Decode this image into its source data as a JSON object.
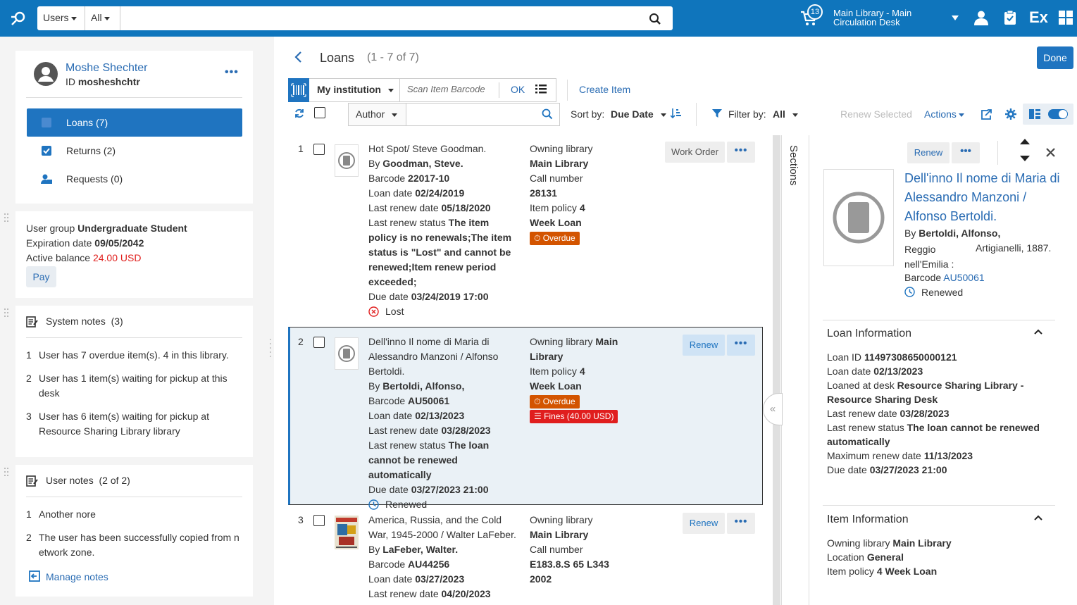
{
  "header": {
    "search_scope": "Users",
    "search_filter": "All",
    "cart_count": "13",
    "library_line1": "Main Library - Main",
    "library_line2": "Circulation Desk",
    "ex_label": "Ex"
  },
  "user": {
    "name": "Moshe Shechter",
    "id_label": "ID",
    "id_value": "mosheshchtr",
    "nav": [
      {
        "label": "Loans (7)"
      },
      {
        "label": "Returns  (2)"
      },
      {
        "label": "Requests  (0)"
      }
    ],
    "group_label": "User group",
    "group_value": "Undergraduate Student",
    "expiration_label": "Expiration date",
    "expiration_value": "09/05/2042",
    "balance_label": "Active balance",
    "balance_value": "24.00 USD",
    "pay_label": "Pay"
  },
  "system_notes": {
    "title": "System notes",
    "count": "(3)",
    "items": [
      {
        "n": "1",
        "text": "User has 7 overdue item(s). 4 in this library."
      },
      {
        "n": "2",
        "text": "User has 1 item(s) waiting for pickup at this desk"
      },
      {
        "n": "3",
        "text": "User has 6 item(s) waiting for pickup at Resource Sharing Library library"
      }
    ]
  },
  "user_notes": {
    "title": "User notes",
    "count": "(2 of 2)",
    "items": [
      {
        "n": "1",
        "text": "Another nore"
      },
      {
        "n": "2",
        "text": "The user has been successfully copied from n etwork zone."
      }
    ],
    "manage_label": "Manage notes"
  },
  "loans": {
    "title": "Loans",
    "count": "(1 - 7 of 7)",
    "done_label": "Done",
    "institution": "My institution",
    "scan_placeholder": "Scan Item Barcode",
    "ok_label": "OK",
    "create_item": "Create Item",
    "author_label": "Author",
    "sort_label": "Sort by:",
    "sort_value": "Due Date",
    "filter_label": "Filter by:",
    "filter_value": "All",
    "renew_selected": "Renew Selected",
    "actions_label": "Actions",
    "rows": [
      {
        "num": "1",
        "title": "Hot Spot/ Steve Goodman.",
        "by_label": "By",
        "by": "Goodman, Steve.",
        "barcode_label": "Barcode",
        "barcode": "22017-10",
        "loan_date_label": "Loan date",
        "loan_date": "02/24/2019",
        "last_renew_label": "Last renew date",
        "last_renew": "05/18/2020",
        "status_label": "Last renew status",
        "status": "The item policy is no renewals;The item status is \"Lost\" and cannot be renewed;Item renew period exceeded;",
        "due_label": "Due date",
        "due": "03/24/2019 17:00",
        "state": "Lost",
        "owning_label": "Owning library",
        "owning": "Main Library",
        "call_label": "Call number",
        "call": "28131",
        "policy_label": "Item policy",
        "policy": "4 Week Loan",
        "badge1": "Overdue",
        "action": "Work Order"
      },
      {
        "num": "2",
        "title": "Dell'inno Il nome di Maria di Alessandro Manzoni / Alfonso Bertoldi.",
        "by_label": "By",
        "by": "Bertoldi, Alfonso,",
        "barcode_label": "Barcode",
        "barcode": "AU50061",
        "loan_date_label": "Loan date",
        "loan_date": "02/13/2023",
        "last_renew_label": "Last renew date",
        "last_renew": "03/28/2023",
        "status_label": "Last renew status",
        "status": "The loan cannot be renewed automatically",
        "due_label": "Due date",
        "due": "03/27/2023 21:00",
        "state": "Renewed",
        "owning_label": "Owning library",
        "owning": "Main Library",
        "policy_label": "Item policy",
        "policy": "4 Week Loan",
        "badge1": "Overdue",
        "badge2": "Fines (40.00 USD)",
        "action": "Renew"
      },
      {
        "num": "3",
        "title": "America, Russia, and the Cold War, 1945-2000 / Walter LaFeber.",
        "by_label": "By",
        "by": "LaFeber, Walter.",
        "barcode_label": "Barcode",
        "barcode": "AU44256",
        "loan_date_label": "Loan date",
        "loan_date": "03/27/2023",
        "last_renew_label": "Last renew date",
        "last_renew": "04/20/2023",
        "owning_label": "Owning library",
        "owning": "Main Library",
        "call_label": "Call number",
        "call": "E183.8.S 65 L343 2002",
        "action": "Renew"
      }
    ]
  },
  "sections_label": "Sections",
  "detail": {
    "renew_label": "Renew",
    "title": "Dell'inno Il nome di Maria di Alessandro Manzoni / Alfonso Bertoldi.",
    "by_label": "By",
    "by": "Bertoldi, Alfonso,",
    "place": "Reggio nell'Emilia :",
    "publisher": "Artigianelli, 1887.",
    "barcode_label": "Barcode",
    "barcode": "AU50061",
    "state": "Renewed",
    "loan_info": {
      "title": "Loan Information",
      "loan_id_label": "Loan ID",
      "loan_id": "11497308650000121",
      "loan_date_label": "Loan date",
      "loan_date": "02/13/2023",
      "desk_label": "Loaned at desk",
      "desk": "Resource Sharing Library - Resource Sharing Desk",
      "last_renew_label": "Last renew date",
      "last_renew": "03/28/2023",
      "status_label": "Last renew status",
      "status": "The loan cannot be renewed automatically",
      "max_label": "Maximum renew date",
      "max": "11/13/2023",
      "due_label": "Due date",
      "due": "03/27/2023 21:00"
    },
    "item_info": {
      "title": "Item Information",
      "owning_label": "Owning library",
      "owning": "Main Library",
      "location_label": "Location",
      "location": "General",
      "policy_label": "Item policy",
      "policy": "4 Week Loan"
    }
  }
}
